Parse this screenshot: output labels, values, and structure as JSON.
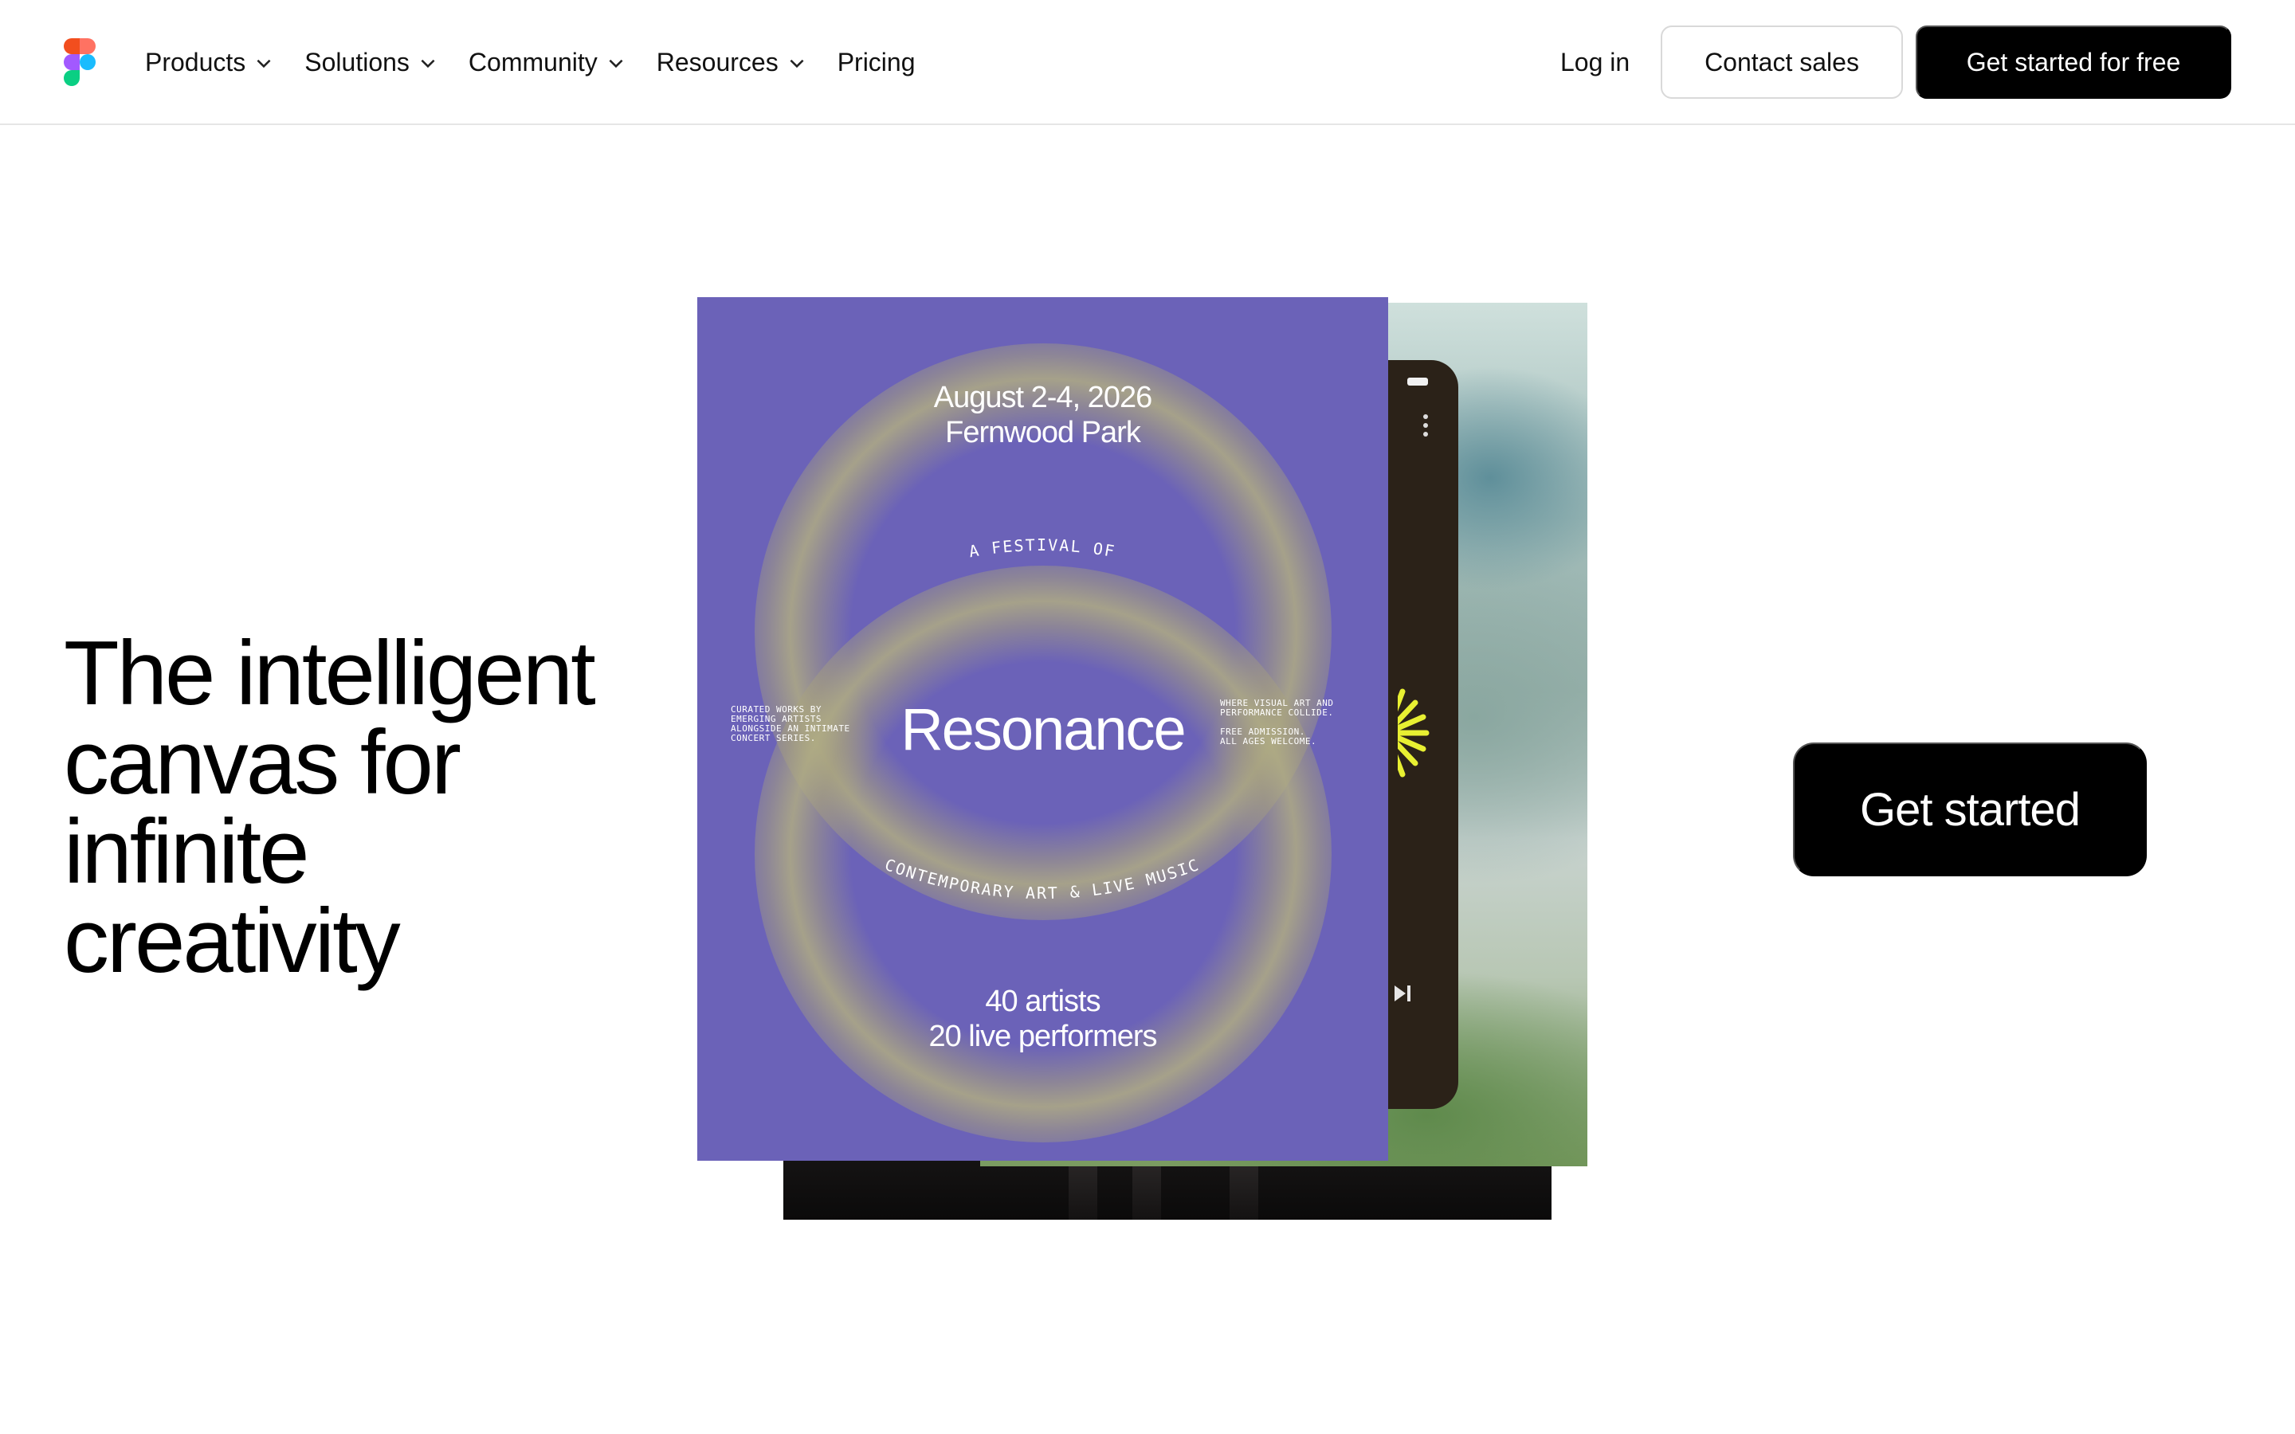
{
  "header": {
    "nav": [
      {
        "label": "Products",
        "has_menu": true
      },
      {
        "label": "Solutions",
        "has_menu": true
      },
      {
        "label": "Community",
        "has_menu": true
      },
      {
        "label": "Resources",
        "has_menu": true
      },
      {
        "label": "Pricing",
        "has_menu": false
      }
    ],
    "login_label": "Log in",
    "contact_label": "Contact sales",
    "signup_label": "Get started for free"
  },
  "hero": {
    "headline": "The intelligent canvas for infinite creativity",
    "cta_label": "Get started"
  },
  "poster": {
    "date_line1": "August 2-4, 2026",
    "date_line2": "Fernwood Park",
    "arc_top": "A FESTIVAL OF",
    "title": "Resonance",
    "left_note": "CURATED WORKS BY\nEMERGING ARTISTS\nALONGSIDE AN INTIMATE\nCONCERT SERIES.",
    "right_note": "WHERE VISUAL ART AND\nPERFORMANCE COLLIDE.\n\nFREE ADMISSION.\nALL AGES WELCOME.",
    "arc_bottom": "CONTEMPORARY ART & LIVE MUSIC",
    "count_line1": "40 artists",
    "count_line2": "20 live performers"
  },
  "colors": {
    "poster_bg": "#6b62b8",
    "ring": "#b0ac82",
    "button_dark": "#000000",
    "accent_yellow": "#e8f032",
    "logo": [
      "#f24e1e",
      "#ff7262",
      "#a259ff",
      "#1abcfe",
      "#0acf83"
    ]
  },
  "icons": [
    "figma-logo-icon",
    "chevron-down-icon",
    "menu-dots-icon",
    "skip-next-icon",
    "sunburst-icon"
  ]
}
